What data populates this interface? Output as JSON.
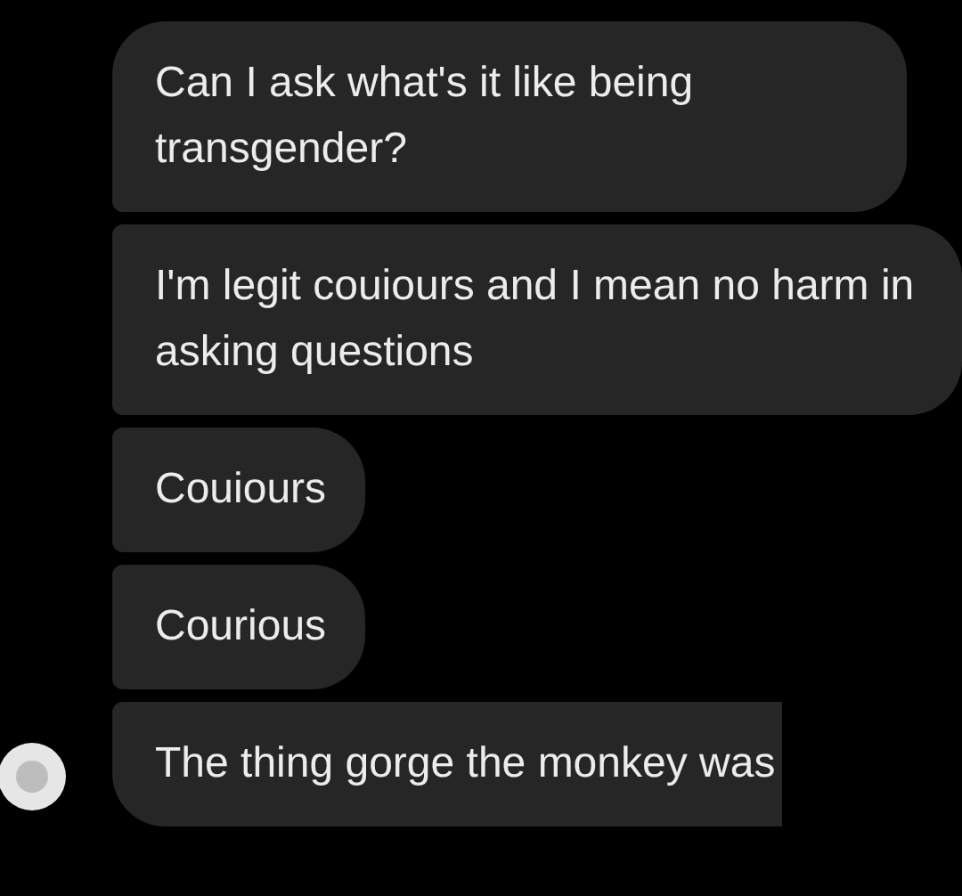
{
  "messages": [
    {
      "text": "Can I ask what's it like being transgender?"
    },
    {
      "text": "I'm legit couiours and I mean no harm in asking questions"
    },
    {
      "text": "Couiours"
    },
    {
      "text": "Courious"
    },
    {
      "text": "The thing gorge the monkey was"
    }
  ]
}
